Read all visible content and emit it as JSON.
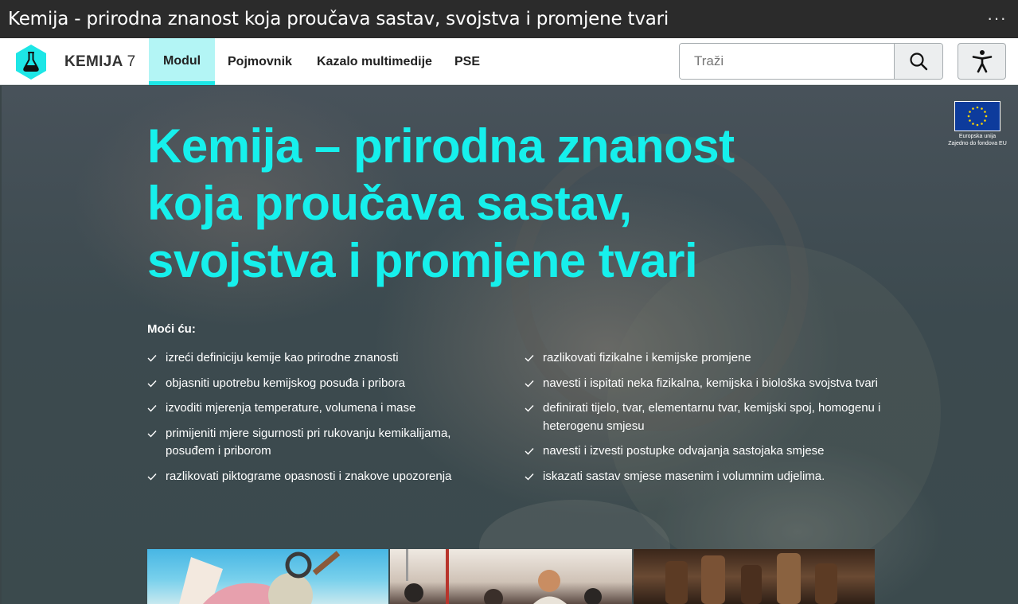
{
  "window": {
    "title": "Kemija - prirodna znanost koja proučava sastav, svojstva i promjene tvari",
    "menu_glyph": "···"
  },
  "nav": {
    "brand_name": "KEMIJA",
    "brand_grade": "7",
    "items": [
      {
        "label": "Modul",
        "active": true
      },
      {
        "label": "Pojmovnik",
        "active": false
      },
      {
        "label": "Kazalo multimedije",
        "active": false
      },
      {
        "label": "PSE",
        "active": false
      }
    ],
    "search_placeholder": "Traži",
    "accent_color": "#1de6e6"
  },
  "hero": {
    "title_lines": [
      "Kemija – prirodna znanost",
      "koja proučava sastav,",
      "svojstva i promjene tvari"
    ],
    "title_color": "#16f0ec",
    "can_do_label": "Moći ću:",
    "goals_left": [
      "izreći definiciju kemije kao prirodne znanosti",
      "objasniti upotrebu kemijskog posuđa i pribora",
      "izvoditi mjerenja temperature, volumena i mase",
      "primijeniti mjere sigurnosti pri rukovanju kemikalijama, posuđem i priborom",
      "razlikovati piktograme opasnosti i znakove upozorenja"
    ],
    "goals_right": [
      "razlikovati fizikalne i kemijske promjene",
      "navesti i ispitati neka fizikalna, kemijska i biološka svojstva tvari",
      "definirati tijelo, tvar, elementarnu tvar, kemijski spoj, homogenu i heterogenu smjesu",
      "navesti i izvesti postupke odvajanja sastojaka smjese",
      "iskazati sastav smjese masenim i volumnim udjelima."
    ],
    "eu_line1": "Europska unija",
    "eu_line2": "Zajedno do fondova EU"
  },
  "icons": {
    "logo": "flask-hexagon-icon",
    "search": "search-icon",
    "accessibility": "accessibility-icon",
    "check": "check-icon"
  }
}
